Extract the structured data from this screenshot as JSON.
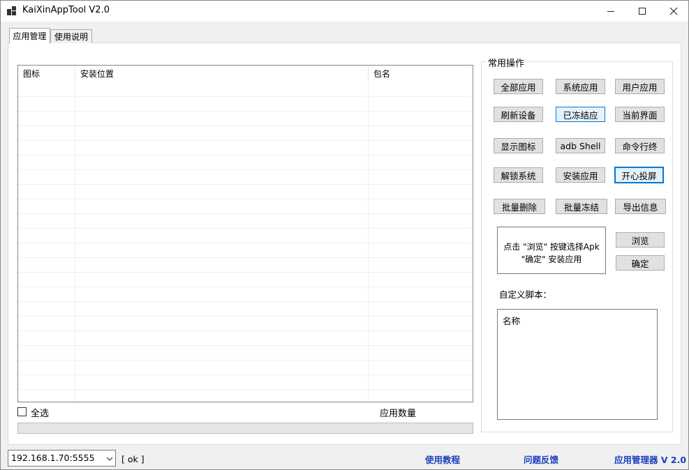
{
  "window": {
    "title": "KaiXinAppTool V2.0",
    "controls": [
      "minimize-icon",
      "maximize-icon",
      "close-icon"
    ]
  },
  "tabs": [
    {
      "label": "应用管理",
      "active": true
    },
    {
      "label": "使用说明",
      "active": false
    }
  ],
  "app_list": {
    "columns": [
      "图标",
      "安装位置",
      "包名"
    ],
    "rows": []
  },
  "select_all_label": "全选",
  "app_count_label": "应用数量",
  "progress": {
    "value": 0
  },
  "actions": {
    "title": "常用操作",
    "buttons": {
      "all_apps": "全部应用",
      "system_apps": "系统应用",
      "user_apps": "用户应用",
      "refresh_device": "刷新设备",
      "frozen_apps": "已冻结应",
      "current_screen": "当前界面",
      "show_icons": "显示图标",
      "adb_shell": "adb Shell",
      "command_line": "命令行终",
      "unlock_system": "解锁系统",
      "install_app": "安装应用",
      "start_cast": "开心投屏",
      "batch_delete": "批量删除",
      "batch_freeze": "批量冻结",
      "export_info": "导出信息",
      "browse": "浏览",
      "confirm": "确定"
    },
    "install_hint": [
      "点击 \"浏览\" 按键选择Apk",
      "\"确定\" 安装应用"
    ],
    "custom_script_label": "自定义脚本：",
    "custom_script_column": "名称"
  },
  "status_bar": {
    "device": "192.168.1.70:5555",
    "status": "[ ok ]",
    "links": {
      "tutorial": "使用教程",
      "feedback": "问题反馈",
      "version": "应用管理器 V 2.0"
    }
  },
  "colors": {
    "accent": "#0078d7",
    "link": "#1a3fbf",
    "window_bg": "#f0f0f0",
    "panel_bg": "#ffffff",
    "button_bg": "#e1e1e1"
  }
}
